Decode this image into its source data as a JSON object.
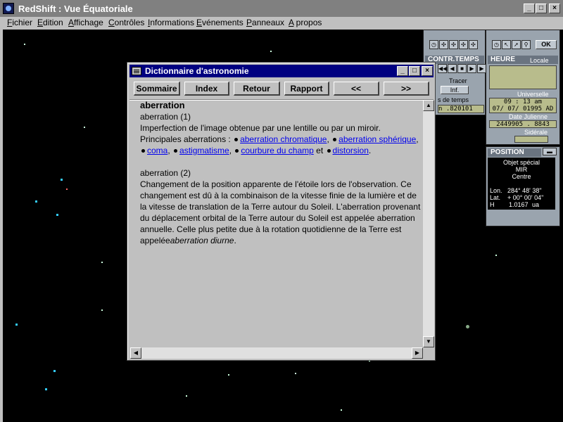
{
  "app": {
    "title": "RedShift : Vue Équatoriale",
    "controls": {
      "minimize": "_",
      "maximize": "□",
      "close": "×"
    }
  },
  "menu": [
    "Fichier",
    "Edition",
    "Affichage",
    "Contrôles",
    "Informations",
    "Evénements",
    "Panneaux",
    "A propos"
  ],
  "panels": {
    "time_control": {
      "header": "CONTR.TEMPS",
      "trace_label": "Tracer",
      "inf_label": "Inf.",
      "step_label": "s de temps",
      "step_value": "n .820101"
    },
    "clock": {
      "header": "HEURE",
      "local_label": "Locale",
      "universal_label": "Universelle",
      "universal_time": "09 : 13 am",
      "universal_date": "07/ 07/ 01995 AD",
      "julian_label": "Date Julienne",
      "julian_value": "2449905 . 8843",
      "sidereal_label": "Sidérale",
      "ok_label": "OK"
    },
    "position": {
      "header": "POSITION",
      "object_label": "Objet spécial",
      "object_name": "MIR",
      "center_label": "Centre",
      "lon_label": "Lon.",
      "lon_value": "284° 48' 38\"",
      "lat_label": "Lat.",
      "lat_value": "+ 00° 00' 04\"",
      "h_label": "H",
      "h_value": "1.0167",
      "h_unit": "ua"
    }
  },
  "dictionary": {
    "title": "Dictionnaire d'astronomie",
    "buttons": {
      "summary": "Sommaire",
      "index": "Index",
      "back": "Retour",
      "report": "Rapport",
      "prev": "<<",
      "next": ">>"
    },
    "entry": {
      "heading": "aberration",
      "def1_title": "aberration (1)",
      "def1_text": "Imperfection de l'image obtenue par une lentille ou par un miroir.",
      "def1_intro": "Principales aberrations :",
      "links": [
        "aberration chromatique",
        "aberration sphérique",
        "coma",
        "astigmatisme",
        "courbure du champ",
        "distorsion"
      ],
      "sep_comma": ",",
      "sep_and": "et",
      "end_dot": ".",
      "def2_title": "aberration (2)",
      "def2_text": "Changement de la position apparente de l'étoile lors de l'observation. Ce changement est dû à la combinaison de la vitesse finie de la lumière et de la vitesse de translation de la Terre autour du Soleil. L'aberration provenant du déplacement orbital de la Terre autour du Soleil est appelée aberration annuelle. Celle plus petite due à la rotation quotidienne de la Terre est appelée",
      "def2_italic": "aberration diurne",
      "def2_end": "."
    }
  }
}
